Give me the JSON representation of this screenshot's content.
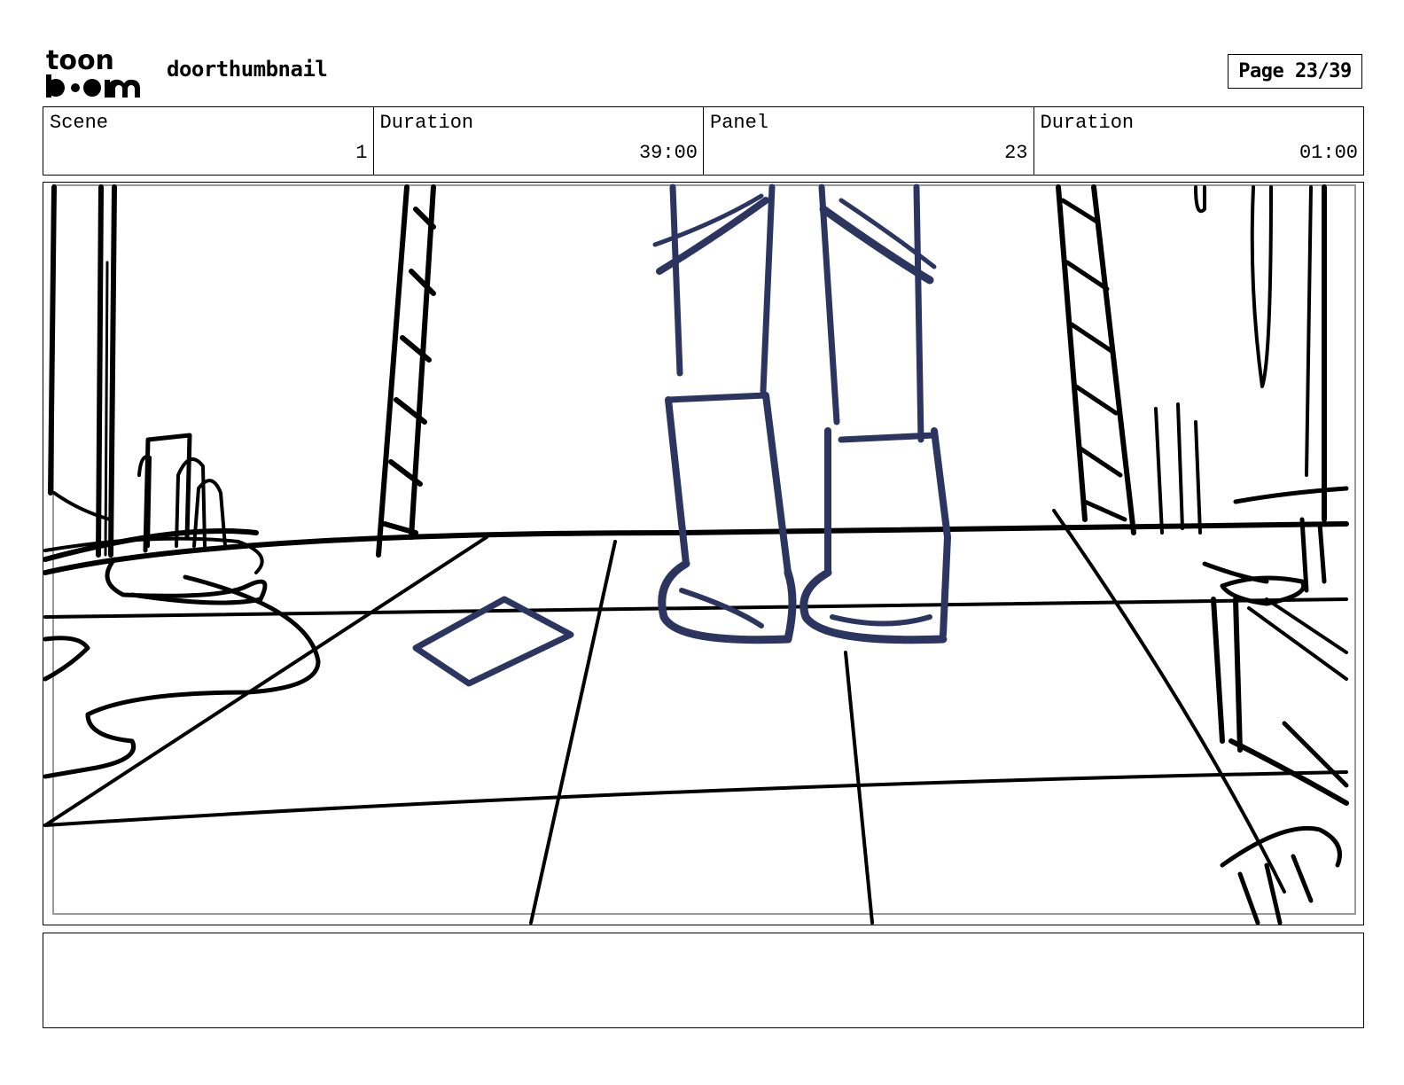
{
  "header": {
    "logo_text_top": "toon",
    "logo_text_bottom": "boom",
    "project_title": "doorthumbnail",
    "page_indicator": "Page 23/39"
  },
  "info": {
    "scene_label": "Scene",
    "scene_value": "1",
    "scene_duration_label": "Duration",
    "scene_duration_value": "39:00",
    "panel_label": "Panel",
    "panel_value": "23",
    "panel_duration_label": "Duration",
    "panel_duration_value": "01:00"
  },
  "colors": {
    "sketch_black": "#000000",
    "character_navy": "#2b3560",
    "safe_area_gray": "#9a9a9a"
  },
  "notes": {
    "text": ""
  }
}
